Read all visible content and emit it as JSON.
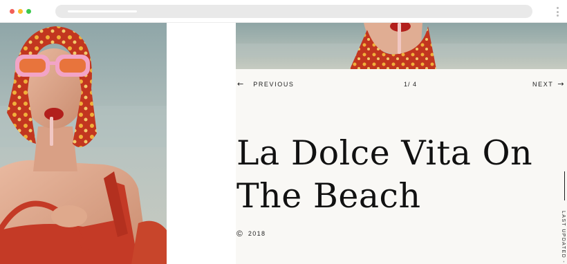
{
  "nav": {
    "previous_label": "PREVIOUS",
    "next_label": "NEXT",
    "counter": "1/ 4"
  },
  "article": {
    "title_line1": "La Dolce Vita On",
    "title_line2": "The Beach",
    "year": "2018"
  },
  "sidebar": {
    "last_updated_label": "LAST UPDATED -"
  },
  "icons": {
    "prev": "arrow-left-icon",
    "next": "arrow-right-icon",
    "copyright": "copyright-icon"
  },
  "colors": {
    "page_background": "#f9f8f5",
    "text": "#111111",
    "scarf_red": "#c2361f",
    "swimsuit_red": "#c43a26"
  }
}
